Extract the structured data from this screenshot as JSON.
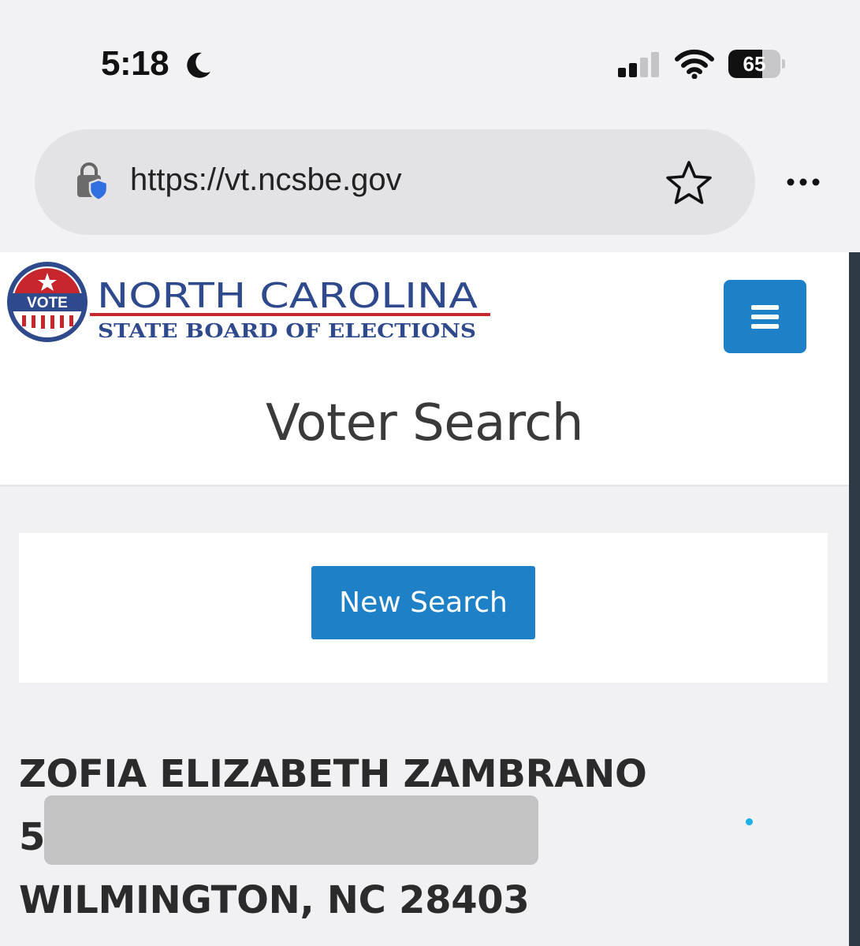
{
  "status_bar": {
    "time": "5:18",
    "battery_level": "65",
    "icons": [
      "moon-icon",
      "cellular-signal-icon",
      "wifi-icon",
      "battery-icon"
    ]
  },
  "browser": {
    "url": "https://vt.ncsbe.gov",
    "icons": [
      "lock-shield-icon",
      "star-bookmark-icon",
      "more-menu-icon"
    ]
  },
  "logo": {
    "vote": "VOTE",
    "line1": "NORTH CAROLINA",
    "line2": "STATE BOARD OF ELECTIONS"
  },
  "page": {
    "title": "Voter Search",
    "new_search_label": "New Search"
  },
  "voter": {
    "name": "ZOFIA ELIZABETH ZAMBRANO",
    "address_line1": "5",
    "address_line2": "WILMINGTON, NC 28403"
  },
  "colors": {
    "primary_button": "#1e81c8",
    "logo_blue": "#2f4a8c",
    "logo_red": "#c8262d",
    "page_background": "#f1f1f4"
  }
}
